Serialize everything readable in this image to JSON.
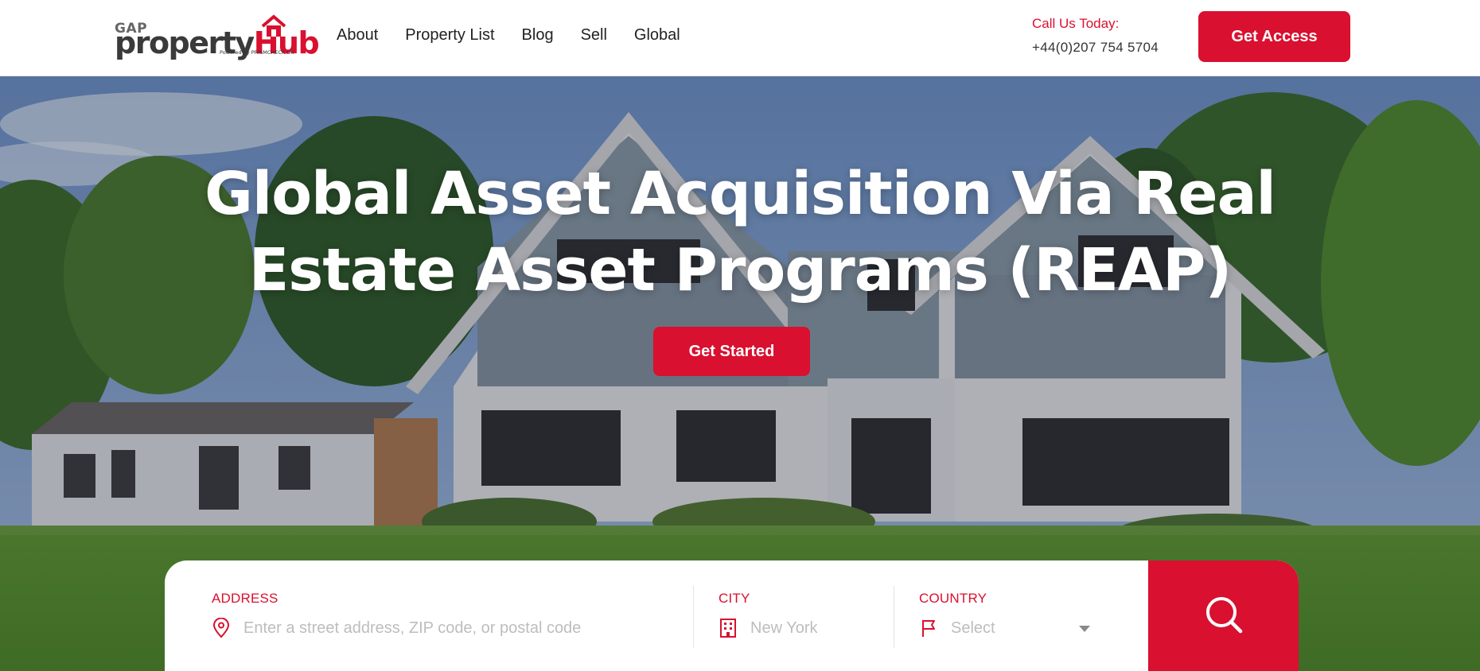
{
  "brand": {
    "logo_top": "GAP",
    "logo_word_dark": "property",
    "logo_word_red": "Hub",
    "logo_tagline": "Powered by PRISMCHECK UK",
    "accent_color": "#d9102f"
  },
  "nav": {
    "items": [
      {
        "label": "About"
      },
      {
        "label": "Property List"
      },
      {
        "label": "Blog"
      },
      {
        "label": "Sell"
      },
      {
        "label": "Global"
      }
    ]
  },
  "contact": {
    "label": "Call Us Today:",
    "phone": "+44(0)207 754 5704"
  },
  "header_cta": {
    "label": "Get Access"
  },
  "hero": {
    "headline_line1": "Global Asset Acquisition Via Real",
    "headline_line2": "Estate Asset Programs (REAP)",
    "cta_label": "Get Started"
  },
  "search": {
    "address": {
      "label": "ADDRESS",
      "placeholder": "Enter a street address, ZIP code, or postal code",
      "icon": "map-pin-icon"
    },
    "city": {
      "label": "CITY",
      "placeholder": "New York",
      "icon": "building-icon"
    },
    "country": {
      "label": "COUNTRY",
      "selected": "Select",
      "icon": "flag-icon"
    },
    "submit_icon": "search-icon"
  }
}
